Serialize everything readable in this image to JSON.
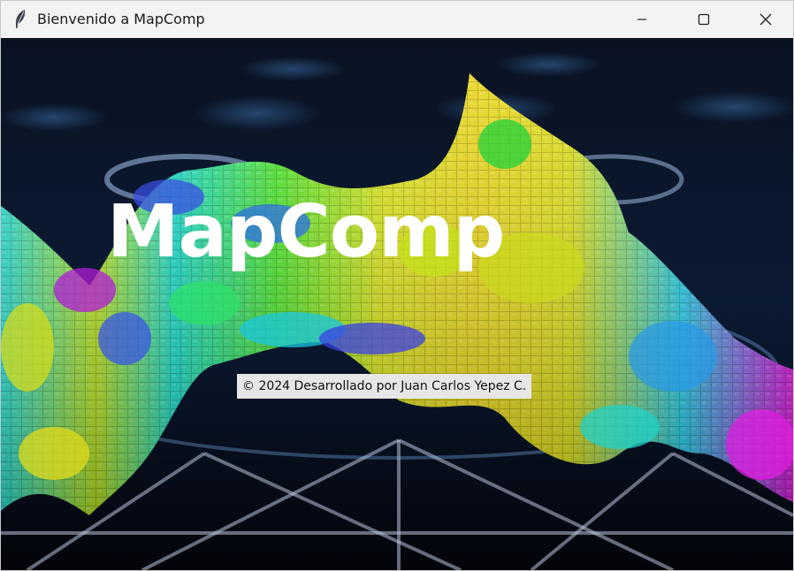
{
  "window": {
    "title": "Bienvenido a MapComp",
    "app_icon": "feather-icon",
    "controls": {
      "minimize_icon": "minimize-icon",
      "maximize_icon": "maximize-icon",
      "close_icon": "close-icon"
    }
  },
  "splash": {
    "app_name": "MapComp",
    "credit": "© 2024 Desarrollado por Juan Carlos Yepez C.",
    "background": "colorful 3D voxel terrain surface over a dark blue grid"
  },
  "colors": {
    "titlebar_bg": "#f3f3f3",
    "content_bg": "#05050d",
    "title_text": "#ffffff",
    "credit_bg": "#e6e6e6"
  }
}
